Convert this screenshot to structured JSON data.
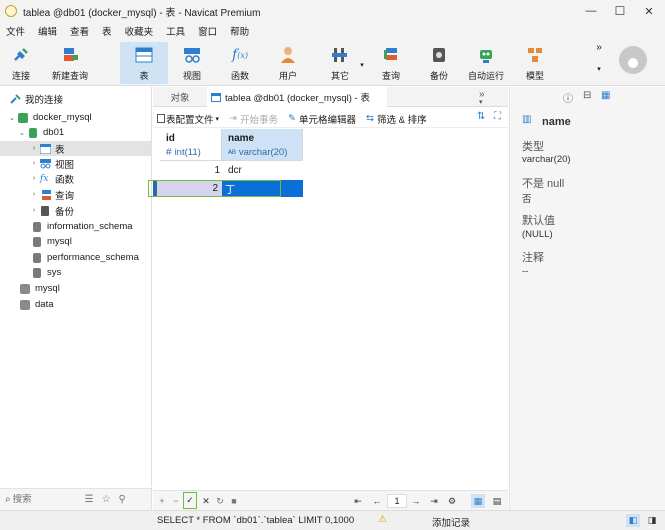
{
  "window": {
    "title": "tablea @db01 (docker_mysql) - 表 - Navicat Premium",
    "minimize": "—",
    "maximize": "☐",
    "close": "✕"
  },
  "menu": [
    "文件",
    "编辑",
    "查看",
    "表",
    "收藏夹",
    "工具",
    "窗口",
    "帮助"
  ],
  "toolbar": {
    "connect": "连接",
    "new_query": "新建查询",
    "table": "表",
    "view": "视图",
    "function": "函数",
    "user": "用户",
    "other": "其它",
    "query": "查询",
    "backup": "备份",
    "auto_run": "自动运行",
    "model": "模型",
    "more": "»"
  },
  "sidebar": {
    "my_connections": "我的连接",
    "connection": "docker_mysql",
    "database": "db01",
    "items": [
      "表",
      "视图",
      "函数",
      "查询",
      "备份"
    ],
    "schemas": [
      "information_schema",
      "mysql",
      "performance_schema",
      "sys"
    ],
    "other_connections": [
      "mysql",
      "data"
    ],
    "search_placeholder": "搜索"
  },
  "tabs": {
    "objects": "对象",
    "active": "tablea @db01 (docker_mysql) - 表"
  },
  "subtoolbar": {
    "config_file": "表配置文件",
    "begin_txn": "开始事务",
    "cell_editor": "单元格编辑器",
    "filter_sort": "筛选 & 排序"
  },
  "grid": {
    "columns": [
      {
        "name": "id",
        "type": "int(11)"
      },
      {
        "name": "name",
        "type": "varchar(20)"
      }
    ],
    "rows": [
      {
        "id": "1",
        "name": "dcr"
      },
      {
        "id": "2",
        "name": "丁"
      }
    ]
  },
  "right_panel": {
    "field_name": "name",
    "type_label": "类型",
    "type_value": "varchar(20)",
    "notnull_label": "不是 null",
    "notnull_value": "否",
    "default_label": "默认值",
    "default_value": "(NULL)",
    "comment_label": "注释",
    "comment_value": "--"
  },
  "nav": {
    "page": "1"
  },
  "status": {
    "sql": "SELECT * FROM `db01`.`tablea` LIMIT 0,1000",
    "message": "添加记录"
  },
  "colors": {
    "accent": "#0a6fd6",
    "selection": "#2d6aa9",
    "green_outline": "#6cbf3a"
  }
}
